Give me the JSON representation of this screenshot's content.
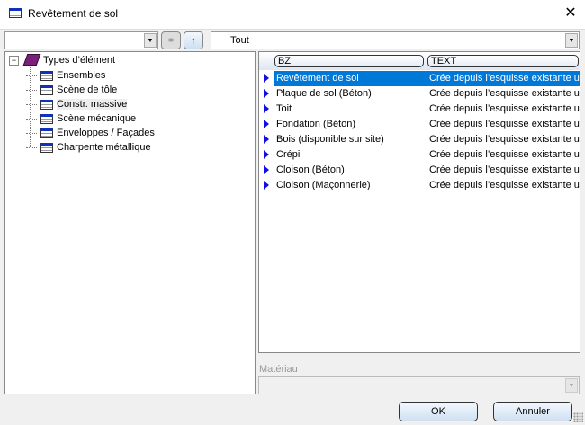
{
  "window": {
    "title": "Revêtement de sol"
  },
  "toolbar": {
    "filter_value": "",
    "scope_value": "Tout"
  },
  "tree": {
    "root": "Types d’élément",
    "items": [
      "Ensembles",
      "Scène de tôle",
      "Constr. massive",
      "Scène mécanique",
      "Enveloppes / Façades",
      "Charpente métallique"
    ],
    "highlighted": "Constr. massive"
  },
  "list": {
    "columns": [
      "BZ",
      "TEXT"
    ],
    "rows": [
      {
        "bz": "Revêtement de sol",
        "text": "Crée depuis l’esquisse existante un"
      },
      {
        "bz": "Plaque de sol (Béton)",
        "text": "Crée depuis l’esquisse existante un"
      },
      {
        "bz": "Toit",
        "text": "Crée depuis l’esquisse existante un"
      },
      {
        "bz": "Fondation (Béton)",
        "text": "Crée depuis l’esquisse existante un"
      },
      {
        "bz": "Bois (disponible sur site)",
        "text": "Crée depuis l’esquisse existante un"
      },
      {
        "bz": "Crépi",
        "text": "Crée depuis l’esquisse existante un"
      },
      {
        "bz": "Cloison (Béton)",
        "text": "Crée depuis l’esquisse existante un"
      },
      {
        "bz": "Cloison (Maçonnerie)",
        "text": "Crée depuis l’esquisse existante un"
      }
    ]
  },
  "material": {
    "label": "Matériau",
    "value": ""
  },
  "buttons": {
    "ok": "OK",
    "cancel": "Annuler"
  },
  "colors": {
    "selection": "#0078d7",
    "arrow": "#1010e0"
  }
}
